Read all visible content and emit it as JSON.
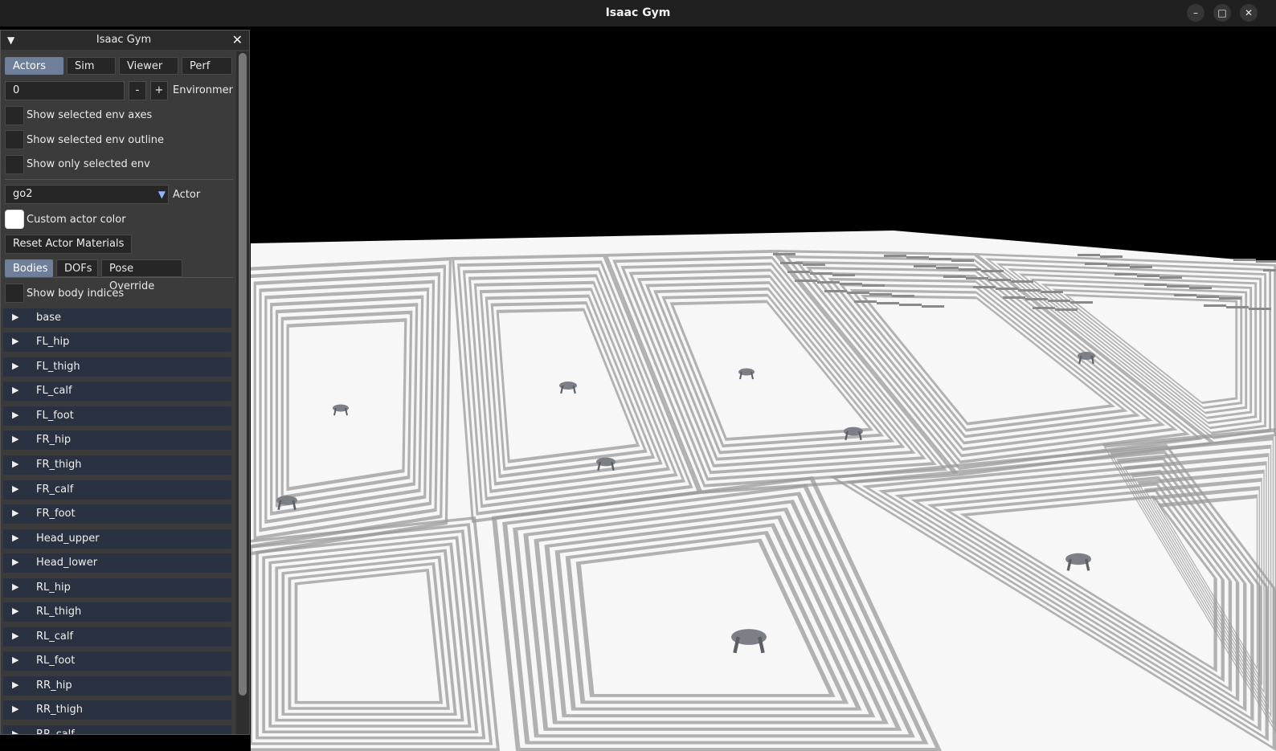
{
  "window": {
    "title": "Isaac Gym",
    "controls": {
      "minimize": "–",
      "maximize": "□",
      "close": "✕"
    }
  },
  "panel": {
    "title": "Isaac Gym",
    "collapse_icon": "▼",
    "close_icon": "✕",
    "tabs": [
      {
        "label": "Actors",
        "active": true
      },
      {
        "label": "Sim",
        "active": false
      },
      {
        "label": "Viewer",
        "active": false
      },
      {
        "label": "Perf",
        "active": false
      }
    ],
    "env_index": {
      "value": "0",
      "minus": "-",
      "plus": "+",
      "label": "Environment"
    },
    "env_checkboxes": [
      "Show selected env axes",
      "Show selected env outline",
      "Show only selected env"
    ],
    "actor_select": {
      "value": "go2",
      "arrow": "▼",
      "label": "Actor"
    },
    "custom_color_label": "Custom actor color",
    "reset_materials_button": "Reset Actor Materials",
    "subtabs": [
      {
        "label": "Bodies",
        "active": true
      },
      {
        "label": "DOFs",
        "active": false
      },
      {
        "label": "Pose Override",
        "active": false
      }
    ],
    "show_body_indices_label": "Show body indices",
    "bodies": [
      "base",
      "FL_hip",
      "FL_thigh",
      "FL_calf",
      "FL_foot",
      "FR_hip",
      "FR_thigh",
      "FR_calf",
      "FR_foot",
      "Head_upper",
      "Head_lower",
      "RL_hip",
      "RL_thigh",
      "RL_calf",
      "RL_foot",
      "RR_hip",
      "RR_thigh",
      "RR_calf"
    ]
  },
  "colors": {
    "titlebar": "#202020",
    "panel_bg": "#3b3b3b",
    "tab_active": "#6f7f99",
    "tree_row": "#2a3140",
    "terrain": "#f7f7f7",
    "stairs": "#9a9a9a"
  }
}
